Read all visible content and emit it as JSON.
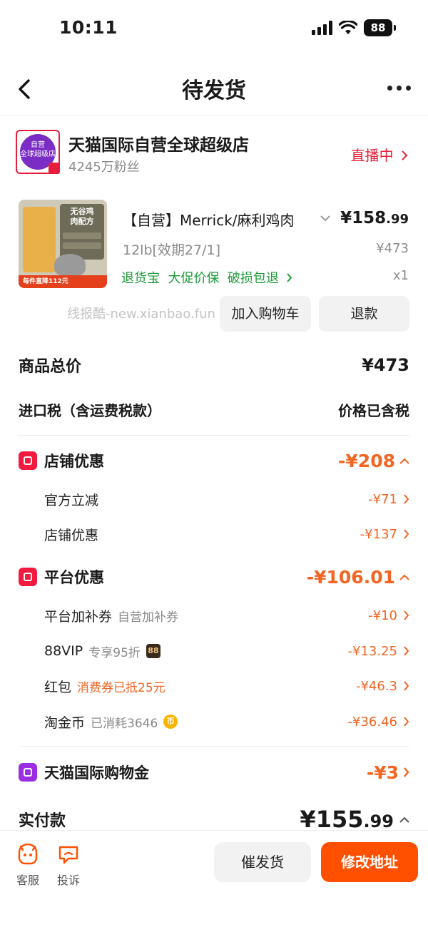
{
  "status_bar": {
    "time": "10:11",
    "battery": "88"
  },
  "nav": {
    "title": "待发货"
  },
  "shop": {
    "logo_text_line1": "自营",
    "logo_text_line2": "全球超级店",
    "name": "天猫国际自营全球超级店",
    "fans": "4245万粉丝",
    "live": "直播中"
  },
  "product": {
    "image_head_line1": "无谷鸡",
    "image_head_line2": "肉配方",
    "image_strip": "每件直降112元",
    "title": "【自营】Merrick/麻利鸡肉",
    "price_main": "¥158",
    "price_decimal": ".99",
    "spec": "12lb[效期27/1]",
    "original_price": "¥473",
    "tags": "退货宝  大促价保  破损包退",
    "quantity": "x1"
  },
  "watermark": "线报酷-new.xianbao.fun",
  "actions": {
    "add_cart": "加入购物车",
    "refund": "退款"
  },
  "summary": {
    "total_label": "商品总价",
    "total_value": "¥473",
    "tax_label": "进口税（含运费税款）",
    "tax_value": "价格已含税"
  },
  "store_discount": {
    "title": "店铺优惠",
    "amount": "-¥208",
    "items": [
      {
        "label": "官方立减",
        "note": "",
        "amount": "-¥71"
      },
      {
        "label": "店铺优惠",
        "note": "",
        "amount": "-¥137"
      }
    ]
  },
  "platform_discount": {
    "title": "平台优惠",
    "amount": "-¥106.01",
    "items": [
      {
        "label": "平台加补券",
        "note": "自营加补券",
        "amount": "-¥10"
      },
      {
        "label": "88VIP",
        "note": "专享95折",
        "badge": "88",
        "amount": "-¥13.25"
      },
      {
        "label": "红包",
        "note": "消费券已抵25元",
        "amount": "-¥46.3"
      },
      {
        "label": "淘金币",
        "note": "已消耗3646",
        "coin": "币",
        "amount": "-¥36.46"
      }
    ]
  },
  "shopping_credit": {
    "title": "天猫国际购物金",
    "amount": "-¥3"
  },
  "payment": {
    "label": "实付款",
    "amount_main": "¥155",
    "amount_decimal": ".99"
  },
  "bottom_bar": {
    "service": "客服",
    "complaint": "投诉",
    "urge": "催发货",
    "change_address": "修改地址"
  },
  "colors": {
    "accent_orange": "#ff5000",
    "discount_orange": "#f26522",
    "live_red": "#e8203a",
    "tag_green": "#1f9a3a"
  }
}
